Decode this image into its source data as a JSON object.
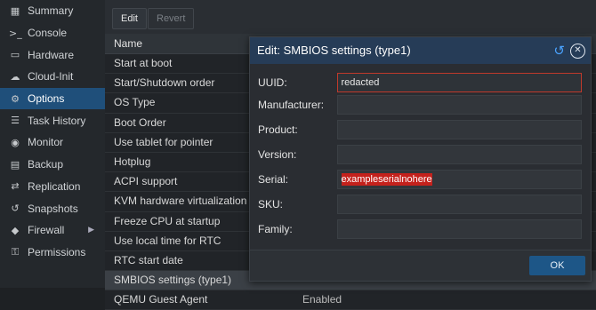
{
  "sidebar": {
    "items": [
      {
        "label": "Summary",
        "icon": "summary-icon",
        "glyph": "▦"
      },
      {
        "label": "Console",
        "icon": "console-icon",
        "glyph": ">_"
      },
      {
        "label": "Hardware",
        "icon": "monitor-icon",
        "glyph": "▭"
      },
      {
        "label": "Cloud-Init",
        "icon": "cloud-icon",
        "glyph": "☁"
      },
      {
        "label": "Options",
        "icon": "gear-icon",
        "glyph": "⚙"
      },
      {
        "label": "Task History",
        "icon": "list-icon",
        "glyph": "☰"
      },
      {
        "label": "Monitor",
        "icon": "eye-icon",
        "glyph": "◉"
      },
      {
        "label": "Backup",
        "icon": "floppy-icon",
        "glyph": "▤"
      },
      {
        "label": "Replication",
        "icon": "retweet-icon",
        "glyph": "⇄"
      },
      {
        "label": "Snapshots",
        "icon": "history-icon",
        "glyph": "↺"
      },
      {
        "label": "Firewall",
        "icon": "shield-icon",
        "glyph": "◆"
      },
      {
        "label": "Permissions",
        "icon": "unlock-icon",
        "glyph": "⚿"
      }
    ],
    "active_index": 4
  },
  "toolbar": {
    "edit_label": "Edit",
    "revert_label": "Revert"
  },
  "grid": {
    "header": "Name",
    "rows": [
      "Start at boot",
      "Start/Shutdown order",
      "OS Type",
      "Boot Order",
      "Use tablet for pointer",
      "Hotplug",
      "ACPI support",
      "KVM hardware virtualization",
      "Freeze CPU at startup",
      "Use local time for RTC",
      "RTC start date",
      "SMBIOS settings (type1)",
      "QEMU Guest Agent"
    ],
    "selected_row": "SMBIOS settings (type1)",
    "partial_value": "Enabled"
  },
  "dialog": {
    "title": "Edit: SMBIOS settings (type1)",
    "fields": [
      {
        "label": "UUID:",
        "value": ""
      },
      {
        "label": "Manufacturer:",
        "value": ""
      },
      {
        "label": "Product:",
        "value": ""
      },
      {
        "label": "Version:",
        "value": ""
      },
      {
        "label": "Serial:",
        "value": ""
      },
      {
        "label": "SKU:",
        "value": ""
      },
      {
        "label": "Family:",
        "value": ""
      }
    ],
    "uuid_value": "redacted",
    "serial_value": "exampleserialnohere",
    "ok_label": "OK"
  },
  "colors": {
    "accent": "#1f4f7a",
    "title_bar": "#263c57",
    "focus_border": "#c0392b",
    "selection": "#c4211c",
    "ok_button": "#1d5687"
  }
}
